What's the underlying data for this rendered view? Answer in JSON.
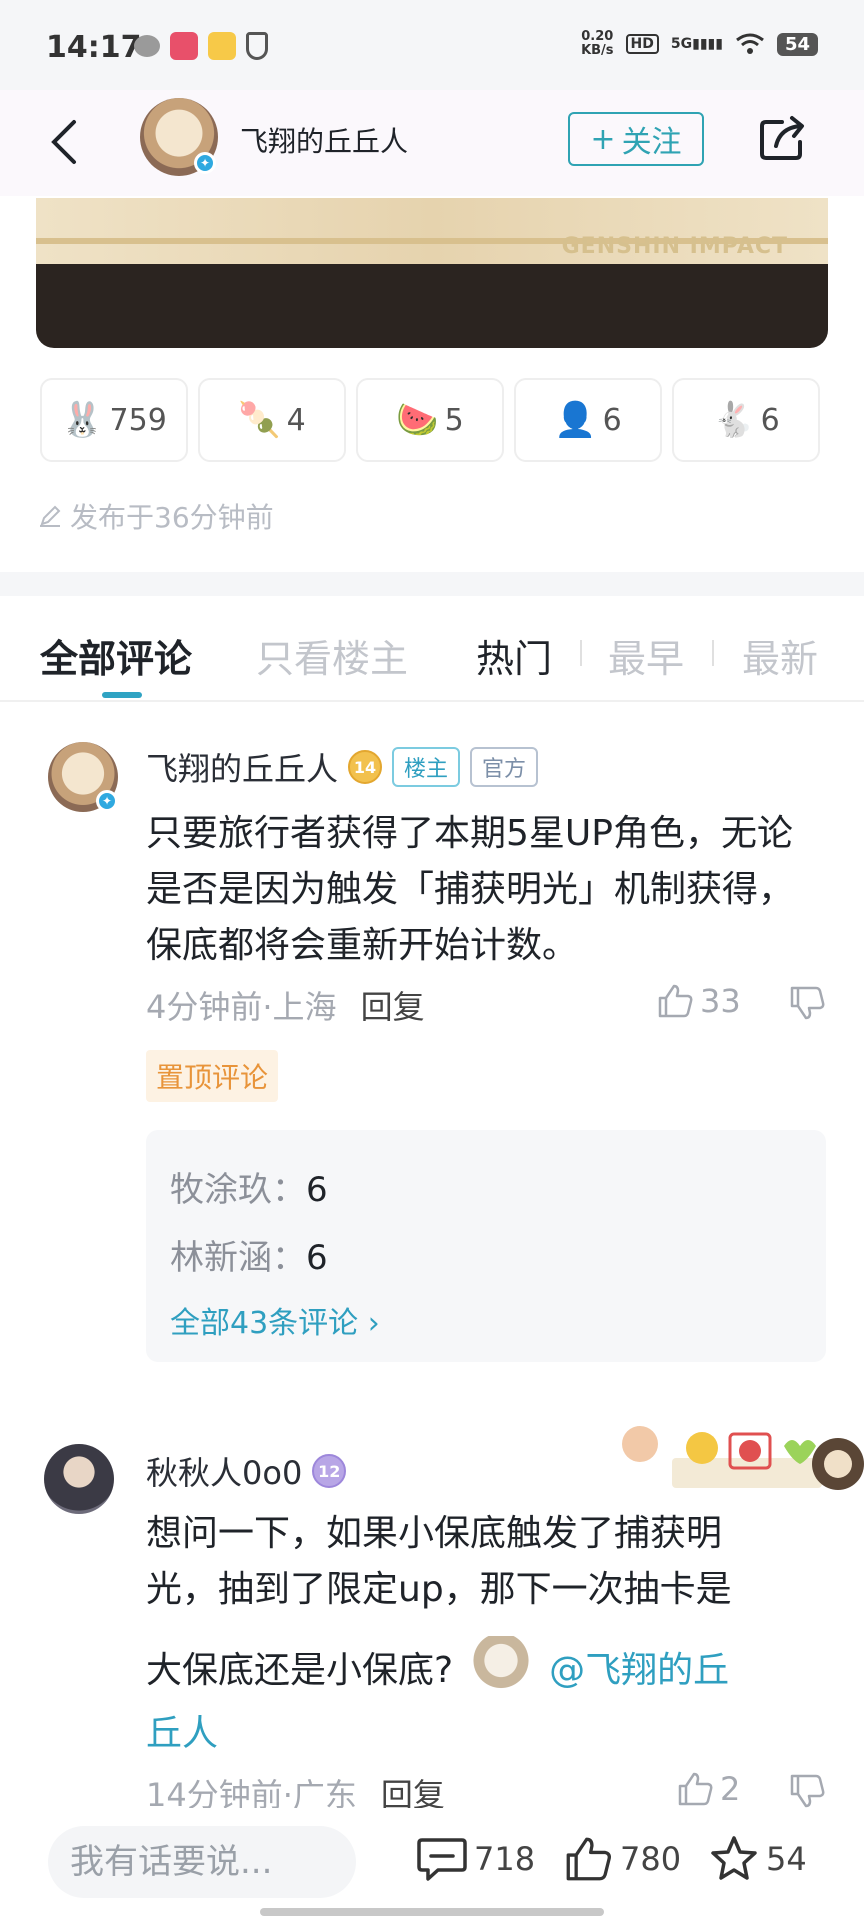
{
  "status_bar": {
    "time": "14:17",
    "net_speed_value": "0.20",
    "net_speed_unit": "KB/s",
    "hd": "HD",
    "signal": "5G",
    "battery": "54"
  },
  "header": {
    "author_name": "飞翔的丘丘人",
    "follow_label": "关注",
    "follow_plus": "+"
  },
  "banner": {
    "logo_text": "GENSHIN IMPACT"
  },
  "reactions": [
    {
      "emoji": "🐰",
      "count": "759"
    },
    {
      "emoji": "🍡",
      "count": "4"
    },
    {
      "emoji": "🍉",
      "count": "5"
    },
    {
      "emoji": "👤",
      "count": "6"
    },
    {
      "emoji": "🐇",
      "count": "6"
    }
  ],
  "published": "发布于36分钟前",
  "tabs": [
    "全部评论",
    "只看楼主",
    "热门",
    "最早",
    "最新"
  ],
  "comments": [
    {
      "name": "飞翔的丘丘人",
      "level": "14",
      "tags": [
        "楼主",
        "官方"
      ],
      "text": "只要旅行者获得了本期5星UP角色，无论是否是因为触发「捕获明光」机制获得，保底都将会重新开始计数。",
      "time": "4分钟前",
      "location": "上海",
      "reply_label": "回复",
      "likes": "33",
      "pinned_label": "置顶评论",
      "replies": [
        {
          "name": "牧涂玖：",
          "text": "6"
        },
        {
          "name": "林新涵：",
          "text": "6"
        }
      ],
      "replies_more": "全部43条评论"
    },
    {
      "name": "秋秋人0o0",
      "level": "12",
      "text_line1": "想问一下，如果小保底触发了捕获明",
      "text_line2": "光，抽到了限定up，那下一次抽卡是",
      "text_line3": "大保底还是小保底?",
      "mention_part1": "@飞翔的丘",
      "mention_part2": "丘人",
      "time": "14分钟前",
      "location": "广东",
      "reply_label": "回复",
      "likes": "2"
    }
  ],
  "bottom_bar": {
    "input_placeholder": "我有话要说...",
    "comments_count": "718",
    "likes_count": "780",
    "favorites_count": "54"
  },
  "colors": {
    "accent": "#2fa3c3",
    "pin_bg": "#fdf2e3",
    "pin_text": "#e8943a"
  }
}
